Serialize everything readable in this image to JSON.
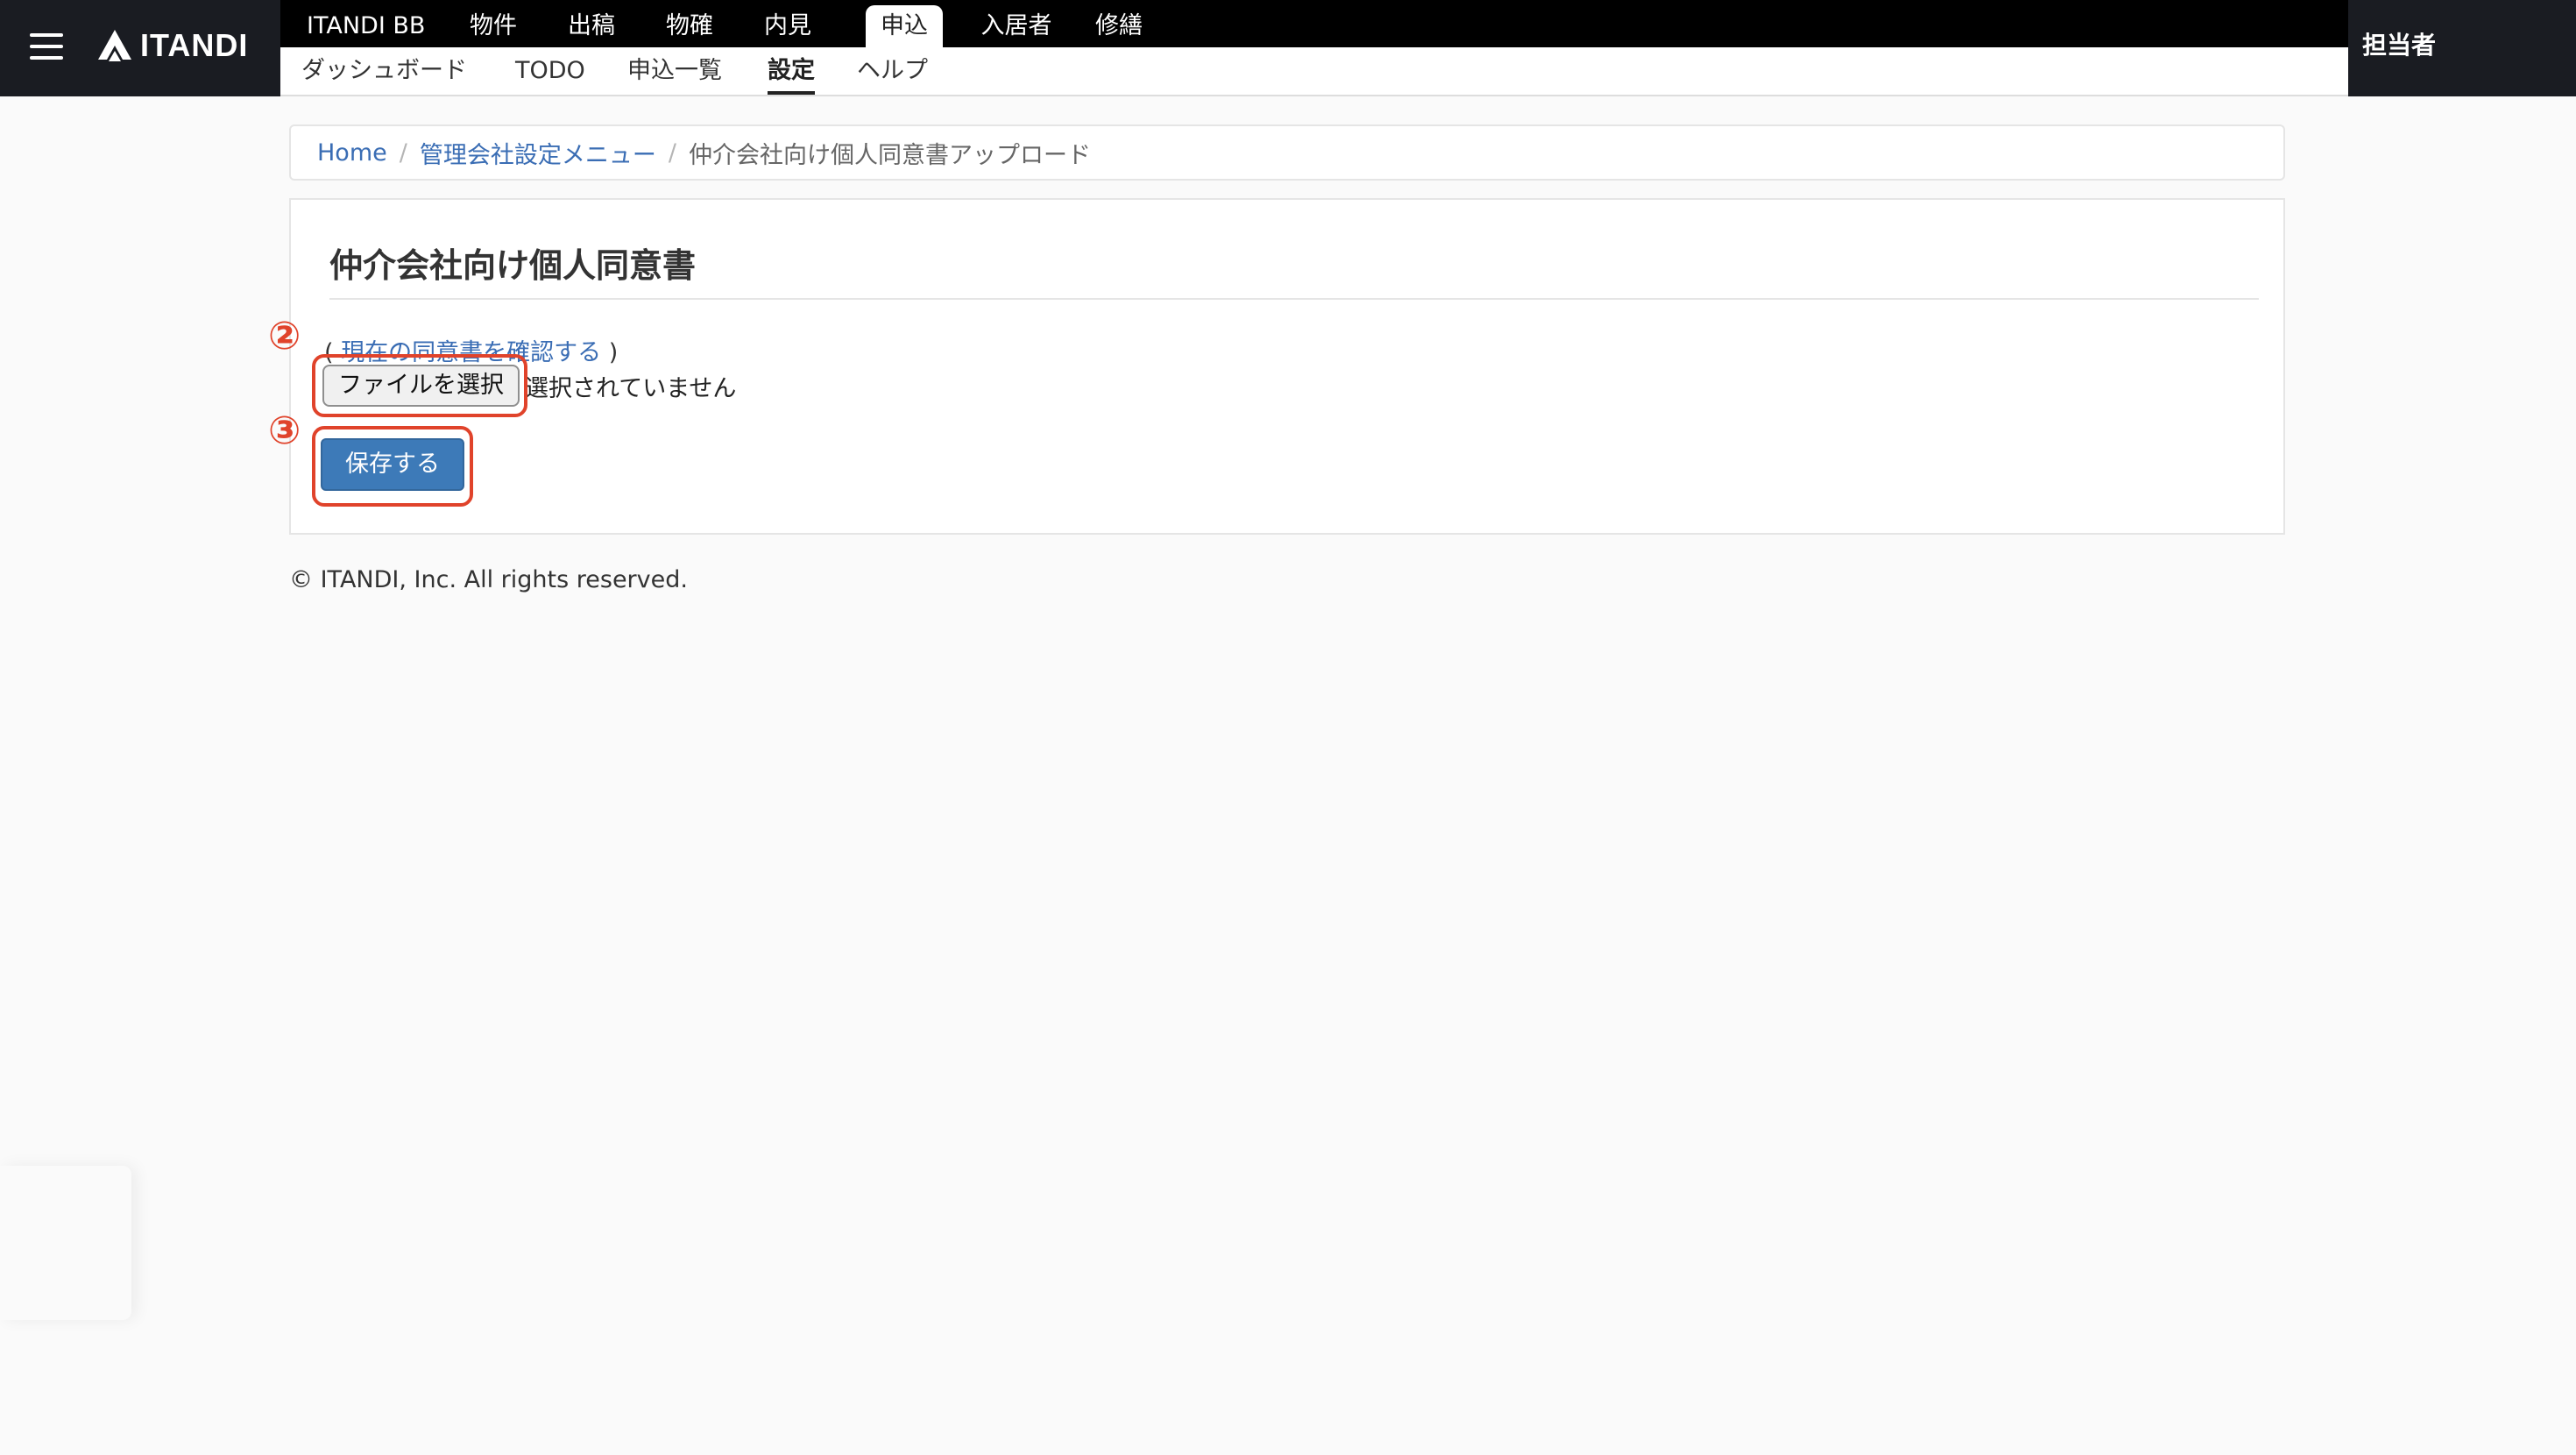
{
  "header": {
    "brand": "ITANDI",
    "top_tabs": [
      {
        "label": "ITANDI BB",
        "active": false
      },
      {
        "label": "物件",
        "active": false
      },
      {
        "label": "出稿",
        "active": false
      },
      {
        "label": "物確",
        "active": false
      },
      {
        "label": "内見",
        "active": false
      },
      {
        "label": "申込",
        "active": true
      },
      {
        "label": "入居者",
        "active": false
      },
      {
        "label": "修繕",
        "active": false
      }
    ],
    "sub_tabs": [
      {
        "label": "ダッシュボード",
        "active": false
      },
      {
        "label": "TODO",
        "active": false
      },
      {
        "label": "申込一覧",
        "active": false
      },
      {
        "label": "設定",
        "active": true
      },
      {
        "label": "ヘルプ",
        "active": false
      }
    ],
    "user_label": "担当者"
  },
  "breadcrumb": {
    "items": [
      "Home",
      "管理会社設定メニュー"
    ],
    "separator": "/",
    "current": "仲介会社向け個人同意書アップロード"
  },
  "panel": {
    "title": "仲介会社向け個人同意書",
    "paren_open": "(",
    "consent_link": "現在の同意書を確認する",
    "paren_close": ")",
    "file_button_label": "ファイルを選択",
    "file_status": "選択されていません",
    "save_label": "保存する"
  },
  "annotations": {
    "step2": "②",
    "step3": "③",
    "color": "#e0432b"
  },
  "footer": {
    "copyright": "© ITANDI, Inc. All rights reserved."
  },
  "colors": {
    "header_bg": "#1a1c22",
    "link": "#3a6db4",
    "primary_button": "#3d7ab8",
    "page_bg": "#fafafa"
  }
}
